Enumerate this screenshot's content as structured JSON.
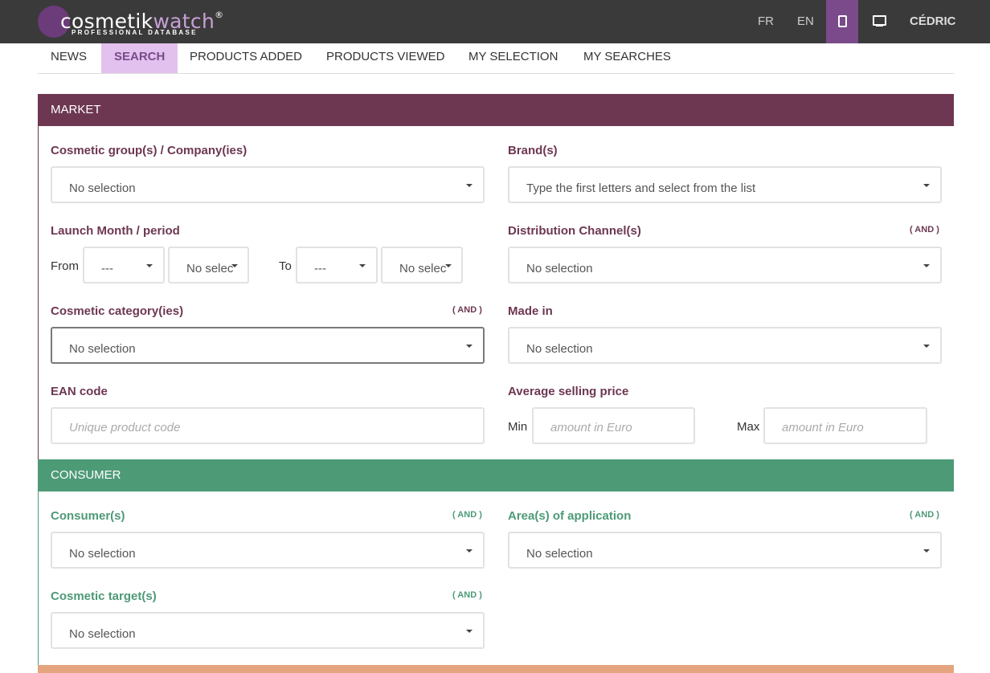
{
  "header": {
    "logo_text_prefix": "c",
    "logo_text_main": "osmetik",
    "logo_text_end": "watch",
    "logo_reg": "®",
    "logo_tagline": "PROFESSIONAL DATABASE",
    "lang_fr": "FR",
    "lang_en": "EN",
    "user": "CÉDRIC"
  },
  "tabs": [
    "NEWS",
    "SEARCH",
    "PRODUCTS ADDED",
    "PRODUCTS VIEWED",
    "MY SELECTION",
    "MY SEARCHES"
  ],
  "active_tab": "SEARCH",
  "market": {
    "title": "MARKET",
    "group_label": "Cosmetic group(s) / Company(ies)",
    "group_value": "No selection",
    "brand_label": "Brand(s)",
    "brand_value": "Type the first letters and select from the list",
    "launch_label": "Launch Month / period",
    "from_label": "From",
    "from_month": "---",
    "from_year": "No selection",
    "to_label": "To",
    "to_month": "---",
    "to_year": "No selection",
    "distribution_label": "Distribution Channel(s)",
    "distribution_and": "( AND )",
    "distribution_value": "No selection",
    "category_label": "Cosmetic category(ies)",
    "category_and": "( AND )",
    "category_value": "No selection",
    "madein_label": "Made in",
    "madein_value": "No selection",
    "ean_label": "EAN code",
    "ean_placeholder": "Unique product code",
    "price_label": "Average selling price",
    "min_label": "Min",
    "min_placeholder": "amount in Euro",
    "max_label": "Max",
    "max_placeholder": "amount in Euro"
  },
  "consumer": {
    "title": "CONSUMER",
    "consumer_label": "Consumer(s)",
    "consumer_and": "( AND )",
    "consumer_value": "No selection",
    "area_label": "Area(s) of application",
    "area_and": "( AND )",
    "area_value": "No selection",
    "target_label": "Cosmetic target(s)",
    "target_and": "( AND )",
    "target_value": "No selection"
  },
  "colors": {
    "market": "#6d3752",
    "consumer": "#4d9a77",
    "accent": "#7a4a8a",
    "active_tab_bg": "#e2c1ee",
    "next_section": "#e4a57e"
  },
  "icons": [
    "mobile-icon",
    "desktop-icon",
    "caret-down-icon"
  ]
}
